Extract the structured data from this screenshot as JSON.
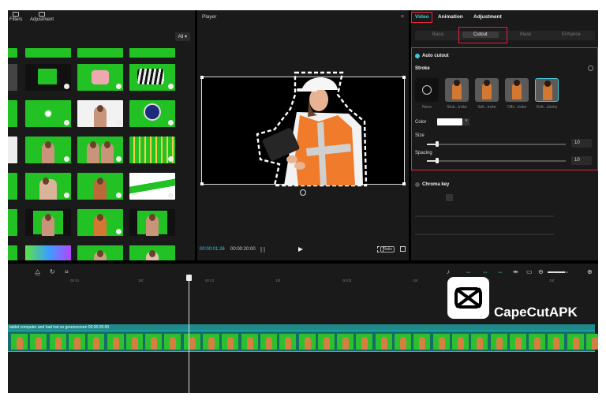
{
  "media": {
    "tabs": [
      {
        "label": "Filters"
      },
      {
        "label": "Adjustment"
      }
    ],
    "filter_label": "All"
  },
  "player": {
    "title": "Player",
    "current_time": "00:00:01:26",
    "total_time": "00:00:20:00",
    "ratio_label": "Ratio"
  },
  "properties": {
    "tabs": [
      {
        "label": "Video"
      },
      {
        "label": "Animation"
      },
      {
        "label": "Adjustment"
      }
    ],
    "active_tab": "Video",
    "subtabs": [
      {
        "label": "Basic"
      },
      {
        "label": "Cutout"
      },
      {
        "label": "Mask"
      },
      {
        "label": "Enhance"
      }
    ],
    "active_subtab": "Cutout",
    "auto_cutout_label": "Auto cutout",
    "stroke_label": "Stroke",
    "stroke_options": [
      {
        "label": "None"
      },
      {
        "label": "Strai...troke"
      },
      {
        "label": "Soli...troke"
      },
      {
        "label": "Offs...troke"
      },
      {
        "label": "Dott...stroke"
      }
    ],
    "color_label": "Color",
    "color_value": "#ffffff",
    "size_label": "Size",
    "size_value": "10",
    "spacing_label": "Spacing",
    "spacing_value": "10",
    "chroma_key_label": "Chroma key",
    "accent_color": "#44c8d8",
    "highlight_color": "#e0263c"
  },
  "timeline": {
    "ruler_ticks": [
      "00:01",
      "15f",
      "00:02",
      "15f",
      "00:03",
      "15f",
      "00:04",
      "15f"
    ],
    "clip_title": "tablet computer and had hat on greenscreen  00:00:05:00"
  },
  "watermark": {
    "text": "CapeCutAPK"
  }
}
